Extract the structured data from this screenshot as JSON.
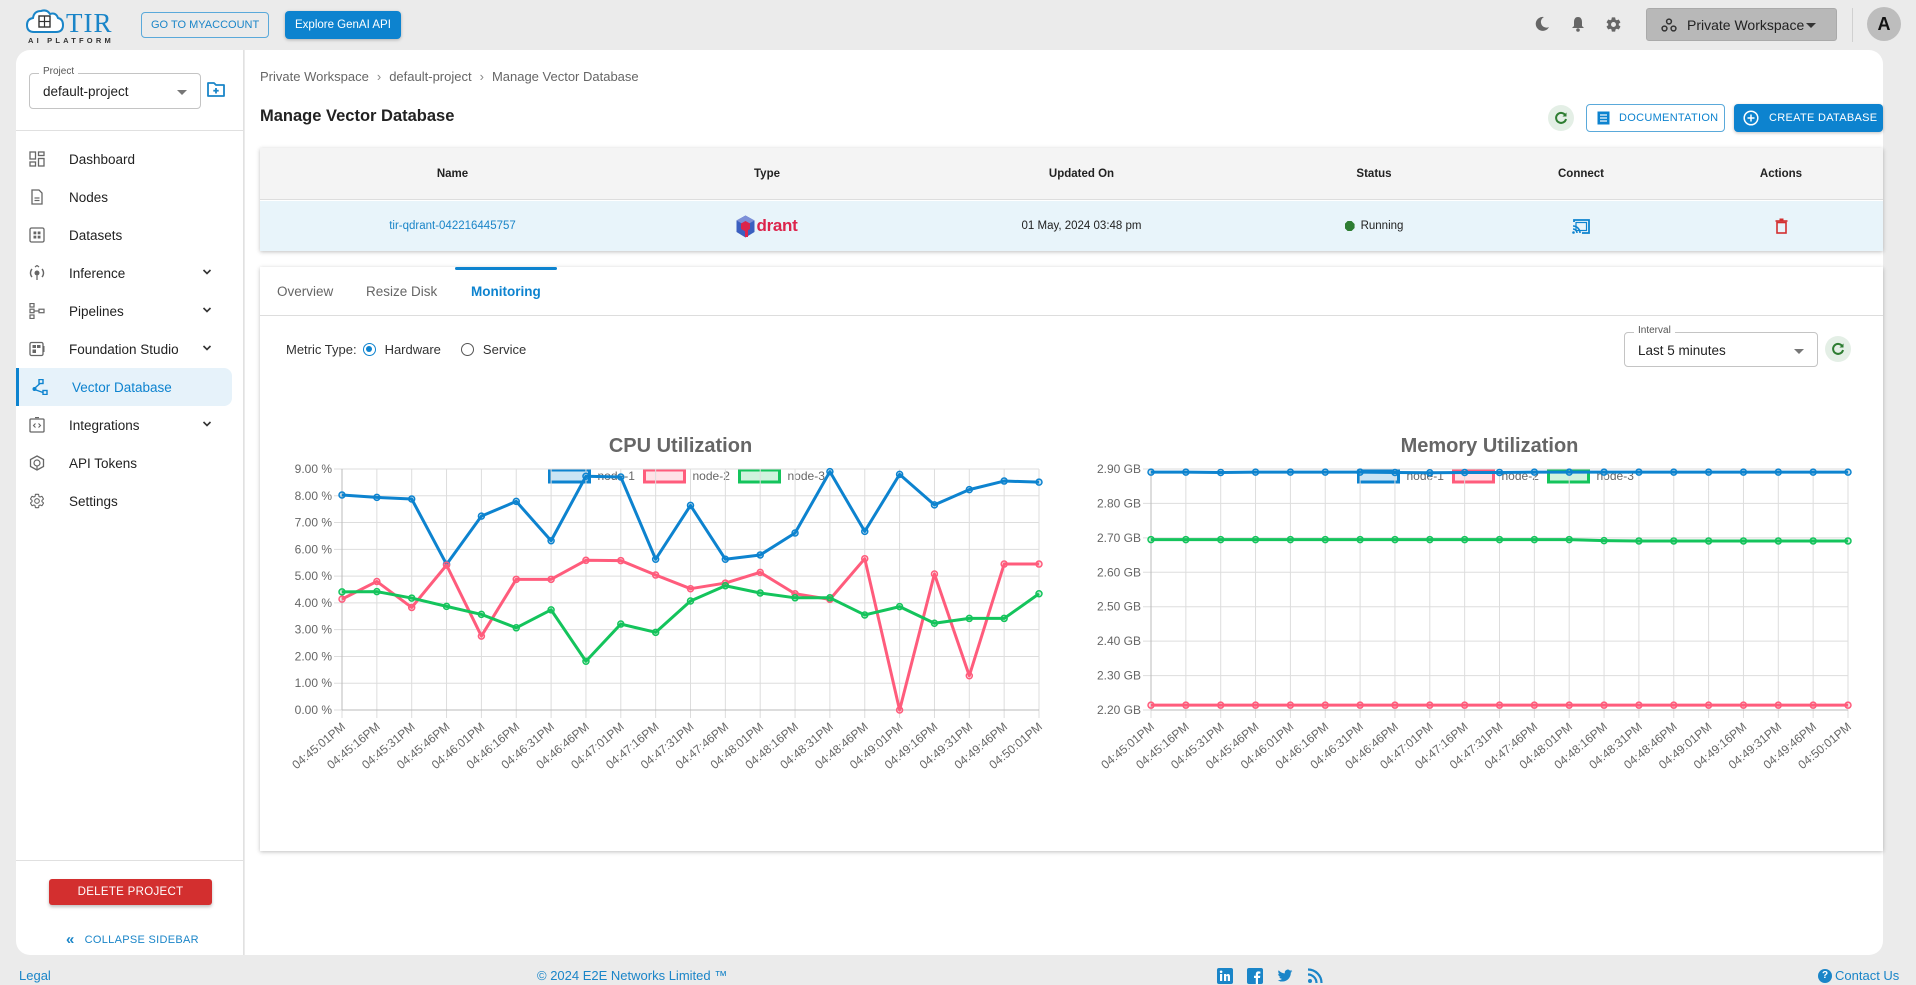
{
  "topbar": {
    "logo_text": "TIR",
    "logo_subtext": "AI PLATFORM",
    "myaccount_label": "GO TO MYACCOUNT",
    "genai_label": "Explore GenAI API",
    "icons": [
      "moon-icon",
      "bell-icon",
      "gear-icon"
    ],
    "workspace_label": "Private Workspace",
    "avatar_initial": "A"
  },
  "sidebar": {
    "project_legend": "Project",
    "project_value": "default-project",
    "items": [
      {
        "label": "Dashboard",
        "icon": "dashboard-icon",
        "expandable": false,
        "active": false
      },
      {
        "label": "Nodes",
        "icon": "document-icon",
        "expandable": false,
        "active": false
      },
      {
        "label": "Datasets",
        "icon": "grid-icon",
        "expandable": false,
        "active": false
      },
      {
        "label": "Inference",
        "icon": "inference-icon",
        "expandable": true,
        "active": false
      },
      {
        "label": "Pipelines",
        "icon": "pipeline-icon",
        "expandable": true,
        "active": false
      },
      {
        "label": "Foundation Studio",
        "icon": "studio-icon",
        "expandable": true,
        "active": false
      },
      {
        "label": "Vector Database",
        "icon": "vector-icon",
        "expandable": false,
        "active": true
      },
      {
        "label": "Integrations",
        "icon": "code-icon",
        "expandable": true,
        "active": false
      },
      {
        "label": "API Tokens",
        "icon": "token-icon",
        "expandable": false,
        "active": false
      },
      {
        "label": "Settings",
        "icon": "gear-icon",
        "expandable": false,
        "active": false
      }
    ],
    "delete_label": "DELETE PROJECT",
    "collapse_label": "COLLAPSE SIDEBAR"
  },
  "main": {
    "breadcrumb": [
      "Private Workspace",
      "default-project",
      "Manage Vector Database"
    ],
    "title": "Manage Vector Database",
    "documentation_label": "DOCUMENTATION",
    "create_label": "CREATE DATABASE",
    "table": {
      "columns": [
        "Name",
        "Type",
        "Updated On",
        "Status",
        "Connect",
        "Actions"
      ],
      "rows": [
        {
          "name": "tir-qdrant-042216445757",
          "type": "drant",
          "updated_on": "01 May, 2024 03:48 pm",
          "status": "Running",
          "status_color": "#2e7d32"
        }
      ]
    },
    "tabs": [
      {
        "label": "Overview",
        "active": false
      },
      {
        "label": "Resize Disk",
        "active": false
      },
      {
        "label": "Monitoring",
        "active": true
      }
    ],
    "metric_type_label": "Metric Type:",
    "metric_options": [
      {
        "label": "Hardware",
        "checked": true
      },
      {
        "label": "Service",
        "checked": false
      }
    ],
    "interval_legend": "Interval",
    "interval_value": "Last 5 minutes"
  },
  "colors": {
    "accent": "#0d83cf",
    "danger": "#d32f2f",
    "node1": "#0d83cf",
    "node2": "#ff5c7c",
    "node3": "#14c45c"
  },
  "chart_data": [
    {
      "type": "line",
      "title": "CPU Utilization",
      "xlabel": "",
      "ylabel": "",
      "ylim": [
        0,
        9
      ],
      "y_ticks": [
        "0.00 %",
        "1.00 %",
        "2.00 %",
        "3.00 %",
        "4.00 %",
        "5.00 %",
        "6.00 %",
        "7.00 %",
        "8.00 %",
        "9.00 %"
      ],
      "grid": true,
      "legend": "top-center",
      "x": [
        "04:45:01PM",
        "04:45:16PM",
        "04:45:31PM",
        "04:45:46PM",
        "04:46:01PM",
        "04:46:16PM",
        "04:46:31PM",
        "04:46:46PM",
        "04:47:01PM",
        "04:47:16PM",
        "04:47:31PM",
        "04:47:46PM",
        "04:48:01PM",
        "04:48:16PM",
        "04:48:31PM",
        "04:48:46PM",
        "04:49:01PM",
        "04:49:16PM",
        "04:49:31PM",
        "04:49:46PM",
        "04:50:01PM"
      ],
      "series": [
        {
          "name": "node-1",
          "values": [
            8.03,
            7.94,
            7.88,
            5.44,
            7.24,
            7.79,
            6.32,
            8.73,
            8.7,
            5.63,
            7.64,
            5.63,
            5.79,
            6.61,
            8.9,
            6.67,
            8.8,
            7.66,
            8.23,
            8.55,
            8.51
          ]
        },
        {
          "name": "node-2",
          "values": [
            4.14,
            4.8,
            3.83,
            5.41,
            2.76,
            4.88,
            4.88,
            5.59,
            5.58,
            5.04,
            4.53,
            4.74,
            5.14,
            4.34,
            4.13,
            5.65,
            0.0,
            5.08,
            1.28,
            5.45,
            5.45
          ]
        },
        {
          "name": "node-3",
          "values": [
            4.41,
            4.42,
            4.18,
            3.87,
            3.57,
            3.07,
            3.74,
            1.82,
            3.21,
            2.9,
            4.07,
            4.64,
            4.37,
            4.19,
            4.19,
            3.55,
            3.86,
            3.24,
            3.42,
            3.42,
            4.34
          ]
        }
      ]
    },
    {
      "type": "line",
      "title": "Memory Utilization",
      "xlabel": "",
      "ylabel": "",
      "ylim": [
        2.2,
        2.9
      ],
      "y_ticks": [
        "2.20 GB",
        "2.30 GB",
        "2.40 GB",
        "2.50 GB",
        "2.60 GB",
        "2.70 GB",
        "2.80 GB",
        "2.90 GB"
      ],
      "grid": true,
      "legend": "top-center",
      "x": [
        "04:45:01PM",
        "04:45:16PM",
        "04:45:31PM",
        "04:45:46PM",
        "04:46:01PM",
        "04:46:16PM",
        "04:46:31PM",
        "04:46:46PM",
        "04:47:01PM",
        "04:47:16PM",
        "04:47:31PM",
        "04:47:46PM",
        "04:48:01PM",
        "04:48:16PM",
        "04:48:31PM",
        "04:48:46PM",
        "04:49:01PM",
        "04:49:16PM",
        "04:49:31PM",
        "04:49:46PM",
        "04:50:01PM"
      ],
      "series": [
        {
          "name": "node-1",
          "values": [
            2.891,
            2.891,
            2.89,
            2.891,
            2.891,
            2.891,
            2.891,
            2.89,
            2.889,
            2.89,
            2.89,
            2.891,
            2.891,
            2.891,
            2.891,
            2.891,
            2.891,
            2.891,
            2.891,
            2.891,
            2.891
          ]
        },
        {
          "name": "node-2",
          "values": [
            2.214,
            2.214,
            2.214,
            2.214,
            2.214,
            2.214,
            2.214,
            2.214,
            2.214,
            2.214,
            2.214,
            2.214,
            2.214,
            2.214,
            2.214,
            2.214,
            2.214,
            2.214,
            2.214,
            2.214,
            2.214
          ]
        },
        {
          "name": "node-3",
          "values": [
            2.695,
            2.695,
            2.695,
            2.695,
            2.695,
            2.695,
            2.695,
            2.695,
            2.695,
            2.695,
            2.695,
            2.695,
            2.695,
            2.692,
            2.691,
            2.691,
            2.691,
            2.691,
            2.691,
            2.691,
            2.691
          ]
        }
      ]
    }
  ],
  "footer": {
    "legal": "Legal",
    "copyright": "© 2024 E2E Networks Limited ™",
    "social": [
      "linkedin-icon",
      "facebook-icon",
      "twitter-icon",
      "rss-icon"
    ],
    "contact": "Contact Us"
  }
}
